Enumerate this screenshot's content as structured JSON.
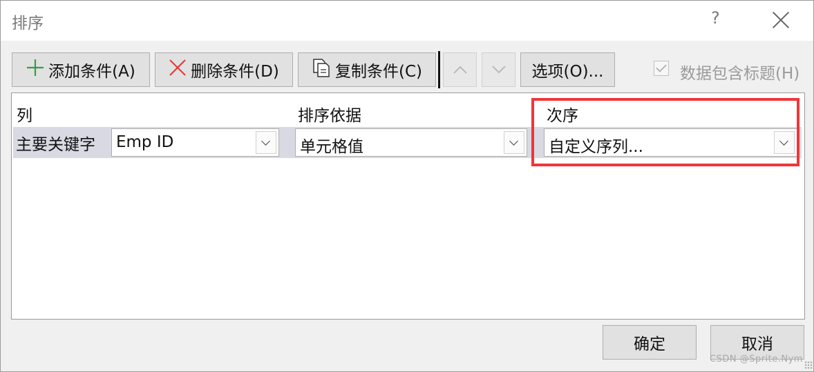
{
  "window": {
    "title": "排序",
    "help_label": "?",
    "close_label": "close"
  },
  "toolbar": {
    "add_label": "添加条件(A)",
    "delete_label": "删除条件(D)",
    "copy_label": "复制条件(C)",
    "options_label": "选项(O)...",
    "up_icon": "chevron-up-icon",
    "down_icon": "chevron-down-icon",
    "header_checkbox_label": "数据包含标题(H)",
    "header_checkbox_checked": true
  },
  "table": {
    "headers": {
      "column": "列",
      "sort_on": "排序依据",
      "order": "次序"
    },
    "rows": [
      {
        "label": "主要关键字",
        "column_value": "Emp ID",
        "sort_on_value": "单元格值",
        "order_value": "自定义序列..."
      }
    ]
  },
  "footer": {
    "ok_label": "确定",
    "cancel_label": "取消"
  },
  "watermark": "CSDN @Sprite.Nym",
  "colors": {
    "highlight": "#f0353a",
    "add_icon": "#2ea043",
    "delete_icon": "#e23b3b",
    "selected_row": "#d9d9e3"
  }
}
